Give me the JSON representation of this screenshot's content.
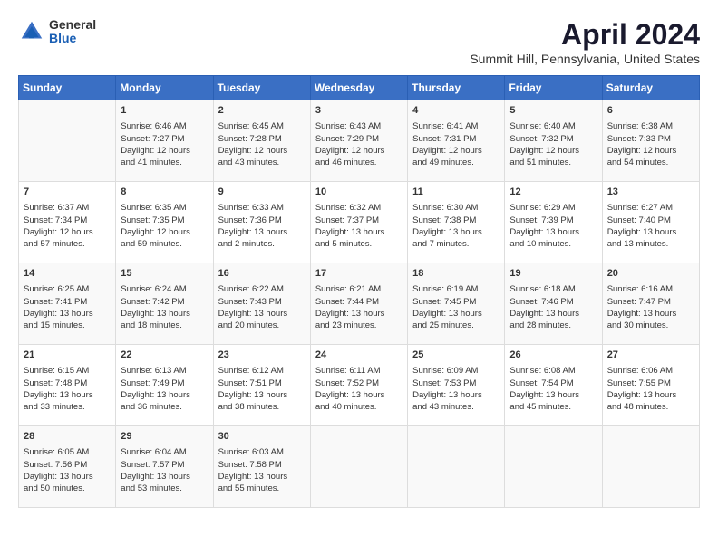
{
  "logo": {
    "general": "General",
    "blue": "Blue"
  },
  "title": "April 2024",
  "subtitle": "Summit Hill, Pennsylvania, United States",
  "calendar": {
    "headers": [
      "Sunday",
      "Monday",
      "Tuesday",
      "Wednesday",
      "Thursday",
      "Friday",
      "Saturday"
    ],
    "weeks": [
      [
        {
          "day": "",
          "info": ""
        },
        {
          "day": "1",
          "info": "Sunrise: 6:46 AM\nSunset: 7:27 PM\nDaylight: 12 hours\nand 41 minutes."
        },
        {
          "day": "2",
          "info": "Sunrise: 6:45 AM\nSunset: 7:28 PM\nDaylight: 12 hours\nand 43 minutes."
        },
        {
          "day": "3",
          "info": "Sunrise: 6:43 AM\nSunset: 7:29 PM\nDaylight: 12 hours\nand 46 minutes."
        },
        {
          "day": "4",
          "info": "Sunrise: 6:41 AM\nSunset: 7:31 PM\nDaylight: 12 hours\nand 49 minutes."
        },
        {
          "day": "5",
          "info": "Sunrise: 6:40 AM\nSunset: 7:32 PM\nDaylight: 12 hours\nand 51 minutes."
        },
        {
          "day": "6",
          "info": "Sunrise: 6:38 AM\nSunset: 7:33 PM\nDaylight: 12 hours\nand 54 minutes."
        }
      ],
      [
        {
          "day": "7",
          "info": "Sunrise: 6:37 AM\nSunset: 7:34 PM\nDaylight: 12 hours\nand 57 minutes."
        },
        {
          "day": "8",
          "info": "Sunrise: 6:35 AM\nSunset: 7:35 PM\nDaylight: 12 hours\nand 59 minutes."
        },
        {
          "day": "9",
          "info": "Sunrise: 6:33 AM\nSunset: 7:36 PM\nDaylight: 13 hours\nand 2 minutes."
        },
        {
          "day": "10",
          "info": "Sunrise: 6:32 AM\nSunset: 7:37 PM\nDaylight: 13 hours\nand 5 minutes."
        },
        {
          "day": "11",
          "info": "Sunrise: 6:30 AM\nSunset: 7:38 PM\nDaylight: 13 hours\nand 7 minutes."
        },
        {
          "day": "12",
          "info": "Sunrise: 6:29 AM\nSunset: 7:39 PM\nDaylight: 13 hours\nand 10 minutes."
        },
        {
          "day": "13",
          "info": "Sunrise: 6:27 AM\nSunset: 7:40 PM\nDaylight: 13 hours\nand 13 minutes."
        }
      ],
      [
        {
          "day": "14",
          "info": "Sunrise: 6:25 AM\nSunset: 7:41 PM\nDaylight: 13 hours\nand 15 minutes."
        },
        {
          "day": "15",
          "info": "Sunrise: 6:24 AM\nSunset: 7:42 PM\nDaylight: 13 hours\nand 18 minutes."
        },
        {
          "day": "16",
          "info": "Sunrise: 6:22 AM\nSunset: 7:43 PM\nDaylight: 13 hours\nand 20 minutes."
        },
        {
          "day": "17",
          "info": "Sunrise: 6:21 AM\nSunset: 7:44 PM\nDaylight: 13 hours\nand 23 minutes."
        },
        {
          "day": "18",
          "info": "Sunrise: 6:19 AM\nSunset: 7:45 PM\nDaylight: 13 hours\nand 25 minutes."
        },
        {
          "day": "19",
          "info": "Sunrise: 6:18 AM\nSunset: 7:46 PM\nDaylight: 13 hours\nand 28 minutes."
        },
        {
          "day": "20",
          "info": "Sunrise: 6:16 AM\nSunset: 7:47 PM\nDaylight: 13 hours\nand 30 minutes."
        }
      ],
      [
        {
          "day": "21",
          "info": "Sunrise: 6:15 AM\nSunset: 7:48 PM\nDaylight: 13 hours\nand 33 minutes."
        },
        {
          "day": "22",
          "info": "Sunrise: 6:13 AM\nSunset: 7:49 PM\nDaylight: 13 hours\nand 36 minutes."
        },
        {
          "day": "23",
          "info": "Sunrise: 6:12 AM\nSunset: 7:51 PM\nDaylight: 13 hours\nand 38 minutes."
        },
        {
          "day": "24",
          "info": "Sunrise: 6:11 AM\nSunset: 7:52 PM\nDaylight: 13 hours\nand 40 minutes."
        },
        {
          "day": "25",
          "info": "Sunrise: 6:09 AM\nSunset: 7:53 PM\nDaylight: 13 hours\nand 43 minutes."
        },
        {
          "day": "26",
          "info": "Sunrise: 6:08 AM\nSunset: 7:54 PM\nDaylight: 13 hours\nand 45 minutes."
        },
        {
          "day": "27",
          "info": "Sunrise: 6:06 AM\nSunset: 7:55 PM\nDaylight: 13 hours\nand 48 minutes."
        }
      ],
      [
        {
          "day": "28",
          "info": "Sunrise: 6:05 AM\nSunset: 7:56 PM\nDaylight: 13 hours\nand 50 minutes."
        },
        {
          "day": "29",
          "info": "Sunrise: 6:04 AM\nSunset: 7:57 PM\nDaylight: 13 hours\nand 53 minutes."
        },
        {
          "day": "30",
          "info": "Sunrise: 6:03 AM\nSunset: 7:58 PM\nDaylight: 13 hours\nand 55 minutes."
        },
        {
          "day": "",
          "info": ""
        },
        {
          "day": "",
          "info": ""
        },
        {
          "day": "",
          "info": ""
        },
        {
          "day": "",
          "info": ""
        }
      ]
    ]
  }
}
